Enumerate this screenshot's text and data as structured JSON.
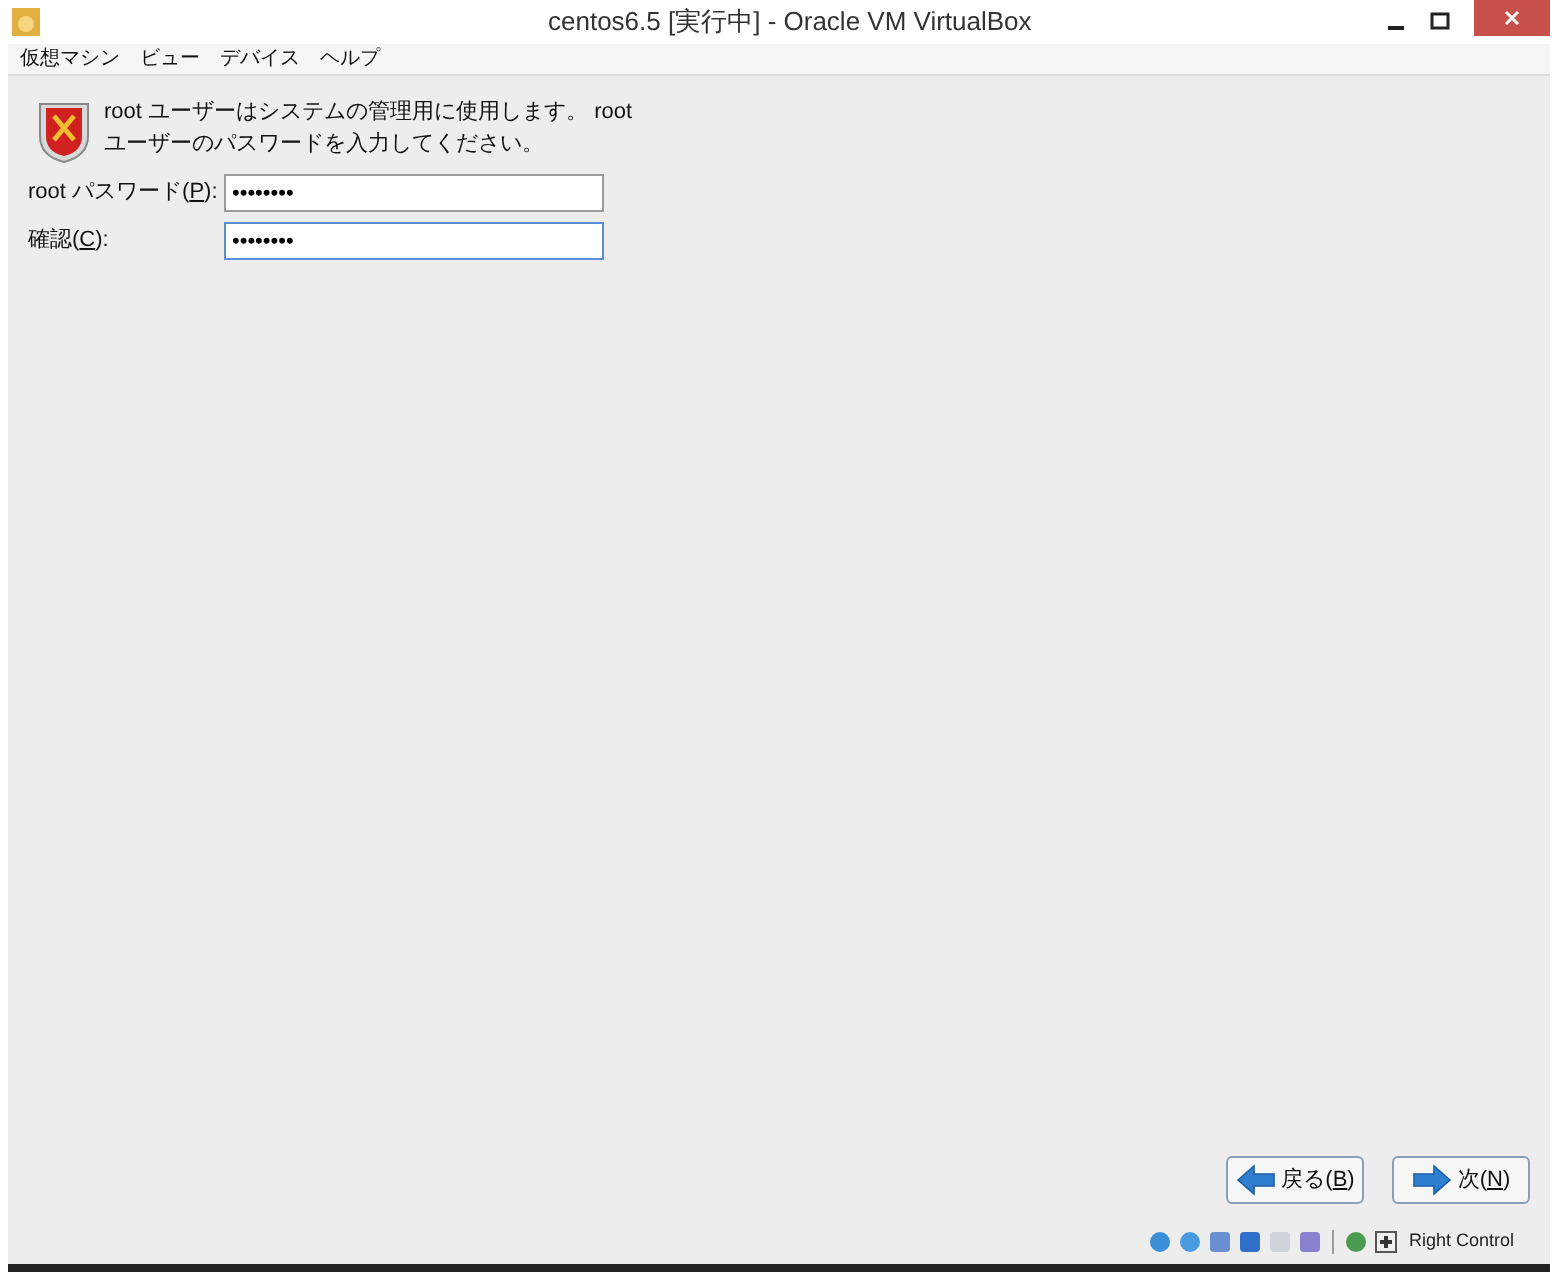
{
  "window": {
    "title": "centos6.5 [実行中] - Oracle VM VirtualBox"
  },
  "menu": [
    "仮想マシン",
    "ビュー",
    "デバイス",
    "ヘルプ"
  ],
  "intro": "root ユーザーはシステムの管理用に使用します。 root ユーザーのパスワードを入力してください。",
  "fields": [
    {
      "label_before": "root パスワード(",
      "mnemonic": "P",
      "label_after": "):",
      "value": "••••••••",
      "focused": false
    },
    {
      "label_before": "確認(",
      "mnemonic": "C",
      "label_after": "):",
      "value": "••••••••",
      "focused": true
    }
  ],
  "buttons": [
    {
      "kind": "back",
      "label_before": "戻る(",
      "mnemonic": "B",
      "label_after": ")"
    },
    {
      "kind": "next",
      "label_before": "次(",
      "mnemonic": "N",
      "label_after": ")"
    }
  ],
  "status_bar": {
    "host_key": "Right Control"
  }
}
